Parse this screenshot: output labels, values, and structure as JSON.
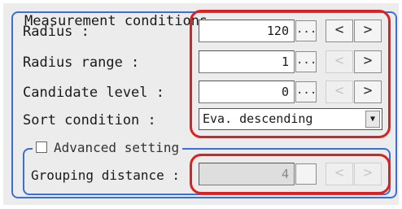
{
  "group": {
    "title": "Measurement conditions"
  },
  "rows": [
    {
      "label": "Radius :",
      "value": "120",
      "enabled": true
    },
    {
      "label": "Radius range :",
      "value": "1",
      "enabled": true
    },
    {
      "label": "Candidate level :",
      "value": "0",
      "enabled": true
    }
  ],
  "sort": {
    "label": "Sort condition :",
    "selected": "Eva. descending"
  },
  "advanced": {
    "checkbox_label": "Advanced setting",
    "checked": false
  },
  "grouping": {
    "label": "Grouping distance :",
    "value": "4",
    "enabled": false
  },
  "buttons": {
    "dots": "...",
    "prev": "<",
    "next": ">",
    "dropdown_arrow": "▼"
  },
  "colors": {
    "highlight": "#e02020",
    "group_border": "#3a6fd8"
  }
}
